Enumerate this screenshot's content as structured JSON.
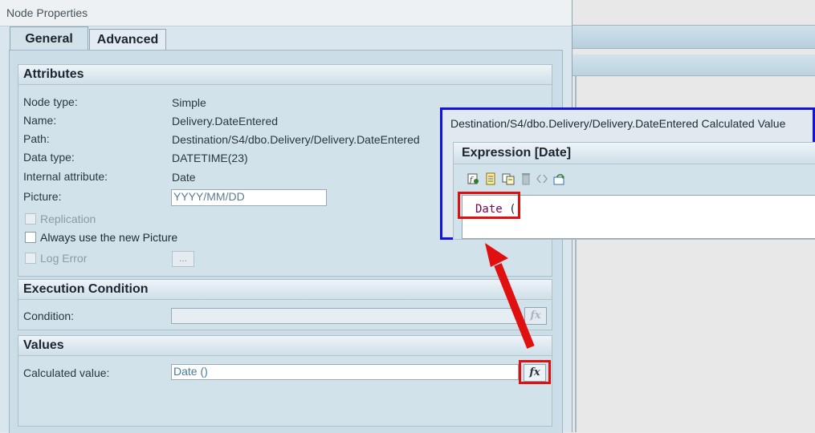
{
  "window": {
    "title": "Node Properties"
  },
  "tabs": [
    {
      "label": "General"
    },
    {
      "label": "Advanced"
    }
  ],
  "attributes": {
    "header": "Attributes",
    "rows": [
      {
        "label": "Node type:",
        "value": "Simple"
      },
      {
        "label": "Name:",
        "value": "Delivery.DateEntered"
      },
      {
        "label": "Path:",
        "value": "Destination/S4/dbo.Delivery/Delivery.DateEntered"
      },
      {
        "label": "Data type:",
        "value": "DATETIME(23)"
      },
      {
        "label": "Internal attribute:",
        "value": "Date"
      }
    ],
    "picture_label": "Picture:",
    "picture_value": "YYYY/MM/DD",
    "replication_label": "Replication",
    "always_new_picture_label": "Always use the new Picture",
    "log_error_label": "Log Error",
    "ellipsis": "..."
  },
  "execution": {
    "header": "Execution Condition",
    "condition_label": "Condition:",
    "condition_value": ""
  },
  "values": {
    "header": "Values",
    "calculated_label": "Calculated value:",
    "calculated_value": "Date ()"
  },
  "fx_label": "fx",
  "popup": {
    "title": "Destination/S4/dbo.Delivery/Delivery.DateEntered Calculated Value",
    "expression_header": "Expression [Date]",
    "toolbar_icons": [
      "insert-function-icon",
      "notepad-icon",
      "copy-icon",
      "delete-icon",
      "brackets-icon",
      "refresh-icon"
    ],
    "code_keyword": "Date",
    "code_rest": " ()"
  },
  "annotation_colors": {
    "highlight": "#e01010",
    "popup_border": "#1414d8"
  }
}
